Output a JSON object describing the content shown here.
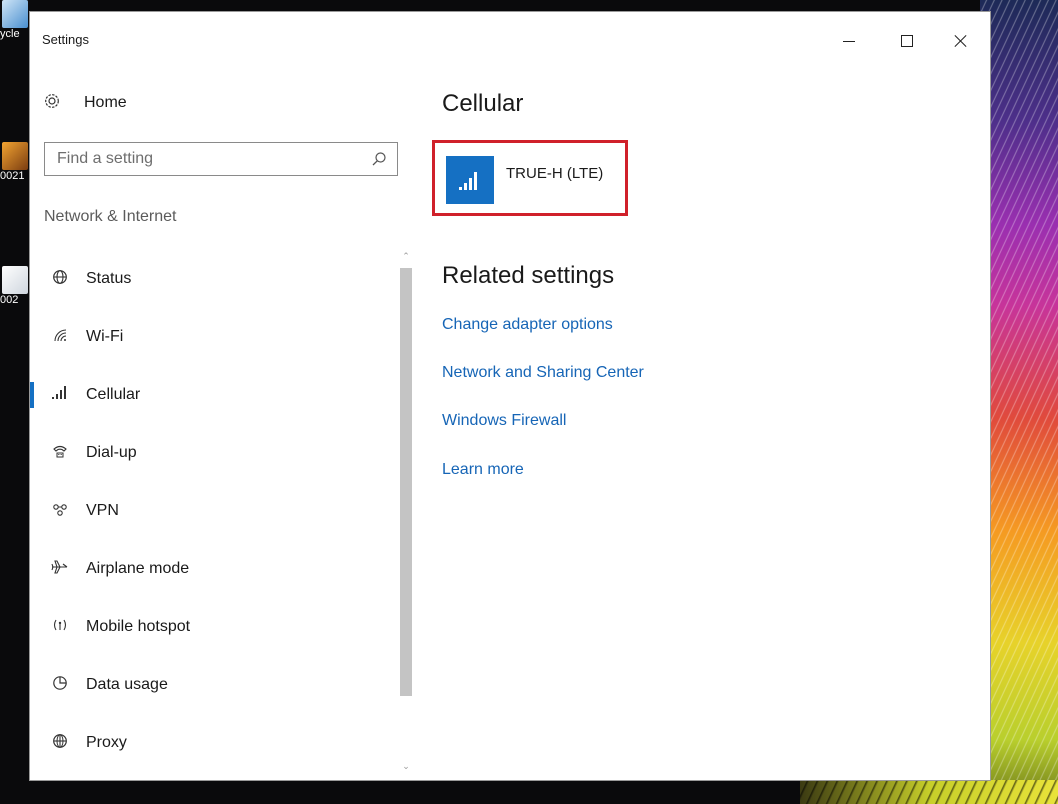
{
  "window": {
    "title": "Settings"
  },
  "desktop_icons": [
    {
      "label": "ycle"
    },
    {
      "label": "0021"
    },
    {
      "label": "002"
    }
  ],
  "nav": {
    "home_label": "Home",
    "search_placeholder": "Find a setting",
    "section_header": "Network & Internet",
    "items": [
      {
        "label": "Status",
        "icon": "status-globe-icon"
      },
      {
        "label": "Wi-Fi",
        "icon": "wifi-icon"
      },
      {
        "label": "Cellular",
        "icon": "cellular-signal-icon",
        "selected": true
      },
      {
        "label": "Dial-up",
        "icon": "dialup-phone-icon"
      },
      {
        "label": "VPN",
        "icon": "vpn-icon"
      },
      {
        "label": "Airplane mode",
        "icon": "airplane-icon"
      },
      {
        "label": "Mobile hotspot",
        "icon": "hotspot-icon"
      },
      {
        "label": "Data usage",
        "icon": "data-usage-icon"
      },
      {
        "label": "Proxy",
        "icon": "globe-icon"
      }
    ]
  },
  "main": {
    "title": "Cellular",
    "connection": {
      "name": "TRUE-H (LTE)"
    },
    "related": {
      "title": "Related settings",
      "links": [
        "Change adapter options",
        "Network and Sharing Center",
        "Windows Firewall",
        "Learn more"
      ]
    }
  },
  "colors": {
    "accent": "#1570c3",
    "link": "#1665b6",
    "highlight_border": "#d0202a"
  }
}
